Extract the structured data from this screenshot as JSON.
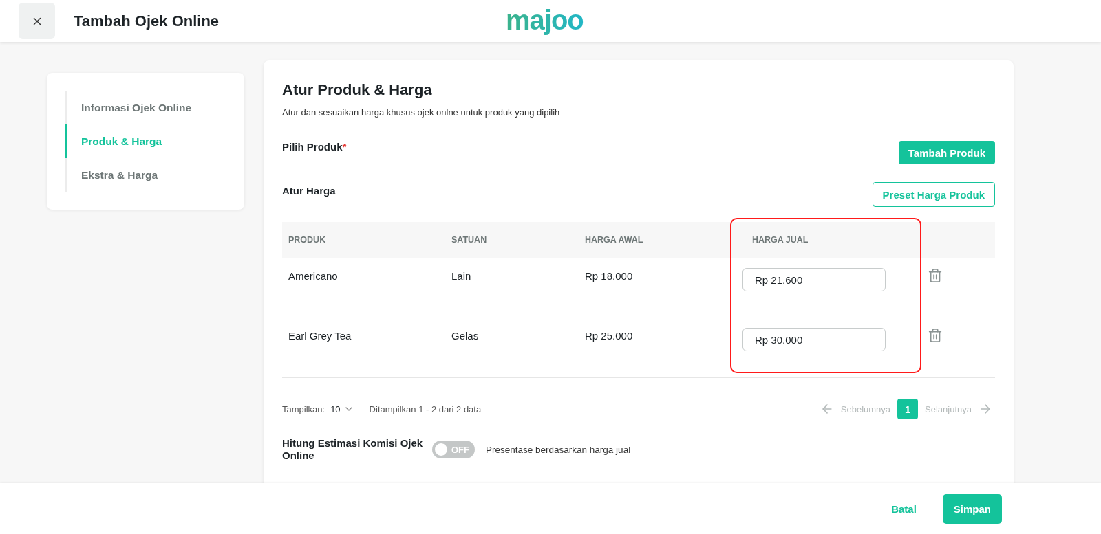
{
  "header": {
    "title": "Tambah Ojek Online",
    "logo": "majoo"
  },
  "sidebar": {
    "items": [
      {
        "label": "Informasi Ojek Online",
        "selected": false
      },
      {
        "label": "Produk & Harga",
        "selected": true
      },
      {
        "label": "Ekstra & Harga",
        "selected": false
      }
    ]
  },
  "section": {
    "title": "Atur Produk & Harga",
    "subtitle": "Atur dan sesuaikan harga khusus ojek onlne untuk produk yang dipilih"
  },
  "pick_product": {
    "label": "Pilih Produk",
    "required_mark": "*",
    "button": "Tambah Produk"
  },
  "set_price": {
    "label": "Atur Harga",
    "button": "Preset Harga Produk"
  },
  "table": {
    "columns": [
      "PRODUK",
      "SATUAN",
      "HARGA AWAL",
      "HARGA JUAL"
    ],
    "rows": [
      {
        "product": "Americano",
        "unit": "Lain",
        "base_price": "Rp 18.000",
        "sell_price": "Rp 21.600"
      },
      {
        "product": "Earl Grey Tea",
        "unit": "Gelas",
        "base_price": "Rp 25.000",
        "sell_price": "Rp 30.000"
      }
    ]
  },
  "pagination": {
    "show_label": "Tampilkan:",
    "page_size": "10",
    "summary": "Ditampilkan 1 - 2 dari 2 data",
    "prev": "Sebelumnya",
    "next": "Selanjutnya",
    "prev_disabled": true,
    "next_disabled": true,
    "pages": [
      {
        "label": "1",
        "selected": true
      }
    ]
  },
  "commission": {
    "label": "Hitung Estimasi Komisi Ojek Online",
    "toggle": {
      "on": false,
      "label": "OFF"
    },
    "description": "Presentase berdasarkan harga jual"
  },
  "footer": {
    "cancel": "Batal",
    "save": "Simpan"
  }
}
